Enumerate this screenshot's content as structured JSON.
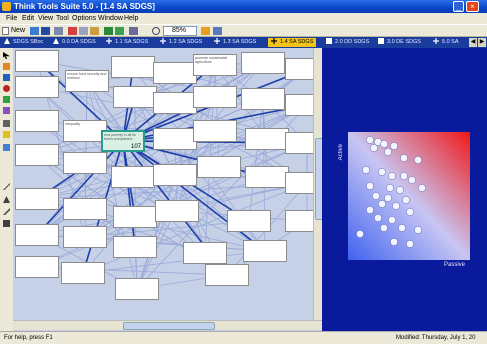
{
  "window": {
    "title": "Think Tools Suite 5.0 - [1.4 SA SDGS]",
    "min_glyph": "_",
    "close_glyph": "×"
  },
  "menu": [
    "File",
    "Edit",
    "View",
    "Tool",
    "Options",
    "Window",
    "Help"
  ],
  "toolbar": {
    "new_label": "New",
    "zoom_value": "85%"
  },
  "tabs": [
    {
      "label": "SDGS SBoc",
      "icon": "arrow-icon",
      "active": false
    },
    {
      "label": "0.0 DA SDGS",
      "icon": "arrow-icon",
      "active": false
    },
    {
      "label": "1.1 SA SDGS",
      "icon": "cross-icon",
      "active": false
    },
    {
      "label": "1.2 SA SDGS",
      "icon": "cross-icon",
      "active": false
    },
    {
      "label": "1.3 SA SDGS",
      "icon": "cross-icon",
      "active": false
    },
    {
      "label": "1.4 SA SDGS",
      "icon": "cross-icon",
      "active": true
    },
    {
      "label": "2.0 DD SDGS",
      "icon": "grid-icon",
      "active": false
    },
    {
      "label": "3.0 DE SDGS",
      "icon": "grid-icon",
      "active": false
    },
    {
      "label": "5.0 SA",
      "icon": "cross-icon",
      "active": false
    }
  ],
  "diagram": {
    "nodes": [
      {
        "text": "",
        "num": ""
      },
      {
        "text": "ensure food security and nutrition",
        "num": ""
      },
      {
        "text": "",
        "num": ""
      },
      {
        "text": "",
        "num": ""
      },
      {
        "text": "promote sustainable agriculture",
        "num": ""
      },
      {
        "text": "",
        "num": ""
      },
      {
        "text": "",
        "num": ""
      },
      {
        "text": "",
        "num": ""
      },
      {
        "text": "",
        "num": ""
      },
      {
        "text": "",
        "num": ""
      },
      {
        "text": "",
        "num": ""
      },
      {
        "text": "",
        "num": ""
      },
      {
        "text": "",
        "num": ""
      },
      {
        "text": "",
        "num": ""
      },
      {
        "text": "inequality",
        "num": ""
      },
      {
        "text": "",
        "num": ""
      },
      {
        "text": "",
        "num": ""
      },
      {
        "text": "",
        "num": ""
      },
      {
        "text": "",
        "num": ""
      },
      {
        "text": "",
        "num": ""
      },
      {
        "text": "",
        "num": ""
      },
      {
        "text": "",
        "num": ""
      },
      {
        "text": "",
        "num": ""
      },
      {
        "text": "",
        "num": ""
      },
      {
        "text": "",
        "num": ""
      },
      {
        "text": "",
        "num": ""
      },
      {
        "text": "",
        "num": ""
      },
      {
        "text": "",
        "num": ""
      },
      {
        "text": "",
        "num": ""
      },
      {
        "text": "",
        "num": ""
      },
      {
        "text": "",
        "num": ""
      },
      {
        "text": "",
        "num": ""
      },
      {
        "text": "",
        "num": ""
      },
      {
        "text": "",
        "num": ""
      },
      {
        "text": "",
        "num": ""
      },
      {
        "text": "",
        "num": ""
      },
      {
        "text": "",
        "num": ""
      },
      {
        "text": "",
        "num": ""
      },
      {
        "text": "",
        "num": ""
      },
      {
        "text": "",
        "num": ""
      },
      {
        "text": "",
        "num": ""
      },
      {
        "text": "end poverty in all its forms everywhere",
        "num": "107"
      }
    ]
  },
  "matrix": {
    "y_label": "Active",
    "x_label": "Passive",
    "point_count": 32
  },
  "colors": {
    "titlebar": "#0a46c8",
    "tabbar": "#1a3c9c",
    "active_tab": "#f3c31a",
    "canvas": "#c6d0e7",
    "rightpane": "#0a1a9c"
  },
  "status": {
    "left": "For help, press F1",
    "right": "Modified: Thursday, July 1, 20"
  }
}
